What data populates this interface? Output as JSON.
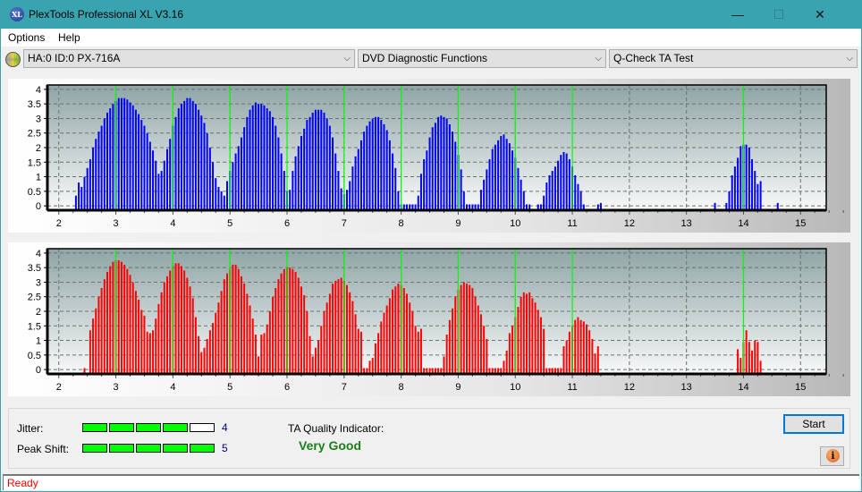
{
  "window": {
    "title": "PlexTools Professional XL V3.16",
    "app_icon_text": "XL",
    "minimize_glyph": "—",
    "maximize_glyph": "☐",
    "close_glyph": "✕"
  },
  "menu": {
    "items": [
      {
        "label": "Options"
      },
      {
        "label": "Help"
      }
    ]
  },
  "toolbar": {
    "drive_select": "HA:0 ID:0  PX-716A",
    "function_select": "DVD Diagnostic Functions",
    "test_select": "Q-Check TA Test",
    "chevron": "⌵"
  },
  "colors": {
    "top_bars": "#0000ff",
    "bottom_bars": "#ff0000",
    "reference_lines": "#00ff00",
    "quality_text": "#1a7f1a",
    "status_text": "#ff0000",
    "meter_on": "#00ff00"
  },
  "chart_data": [
    {
      "type": "bar",
      "title": "",
      "series_name": "top",
      "xlabel": "",
      "ylabel": "",
      "xlim": [
        1.8,
        15.45
      ],
      "ylim": [
        -0.15,
        4.15
      ],
      "xticks": [
        2,
        3,
        4,
        5,
        6,
        7,
        8,
        9,
        10,
        11,
        12,
        13,
        14,
        15
      ],
      "yticks": [
        0,
        0.5,
        1,
        1.5,
        2,
        2.5,
        3,
        3.5,
        4
      ],
      "ytick_labels": [
        "0",
        "0.5",
        "1",
        "1.5",
        "2",
        "2.5",
        "3",
        "3.5",
        "4"
      ],
      "grid": true,
      "reference_lines_x": [
        3,
        4,
        5,
        6,
        7,
        8,
        9,
        10,
        11,
        14
      ],
      "bin_width": 0.05,
      "x_start": 2.3,
      "values": [
        0.35,
        0.8,
        0.65,
        1.0,
        1.3,
        1.6,
        2.0,
        2.3,
        2.55,
        2.75,
        3.0,
        3.2,
        3.35,
        3.5,
        3.6,
        3.7,
        3.7,
        3.7,
        3.65,
        3.55,
        3.45,
        3.3,
        3.15,
        2.95,
        2.75,
        2.5,
        2.2,
        1.9,
        1.55,
        1.1,
        1.2,
        1.55,
        1.95,
        2.3,
        2.75,
        3.05,
        3.35,
        3.5,
        3.6,
        3.7,
        3.7,
        3.6,
        3.5,
        3.3,
        3.1,
        2.85,
        2.5,
        2.0,
        1.5,
        0.95,
        0.65,
        0.5,
        0.35,
        0.85,
        1.2,
        1.5,
        1.8,
        2.05,
        2.35,
        2.7,
        3.05,
        3.3,
        3.45,
        3.55,
        3.5,
        3.5,
        3.45,
        3.35,
        3.25,
        3.05,
        2.75,
        2.35,
        1.8,
        1.2,
        0.5,
        0.55,
        1.2,
        1.7,
        2.05,
        2.4,
        2.65,
        2.95,
        3.05,
        3.2,
        3.3,
        3.3,
        3.3,
        3.2,
        3.0,
        2.75,
        2.35,
        1.8,
        1.2,
        0.6,
        0.4,
        0.55,
        0.85,
        1.35,
        1.7,
        1.95,
        2.25,
        2.55,
        2.75,
        2.9,
        3.0,
        3.05,
        3.05,
        2.95,
        2.8,
        2.6,
        2.25,
        1.8,
        1.3,
        0.5,
        0.05,
        0.05,
        0.05,
        0.05,
        0.05,
        0.05,
        0.35,
        1.1,
        1.6,
        1.9,
        2.35,
        2.7,
        2.85,
        3.05,
        3.1,
        3.05,
        3.0,
        2.8,
        2.55,
        2.2,
        1.75,
        1.25,
        0.5,
        0.05,
        0.05,
        0.05,
        0.05,
        0.05,
        0.55,
        0.9,
        1.25,
        1.6,
        1.95,
        2.1,
        2.25,
        2.4,
        2.45,
        2.3,
        2.15,
        1.9,
        1.65,
        1.3,
        0.9,
        0.5,
        0.05,
        0.05,
        0,
        0,
        0.05,
        0.05,
        0.35,
        0.8,
        1.05,
        1.2,
        1.35,
        1.55,
        1.75,
        1.85,
        1.8,
        1.6,
        1.35,
        1.05,
        0.75,
        0.5,
        0.05,
        0,
        0,
        0,
        0,
        0.05
      ],
      "extra_bars": [
        {
          "x": 10.5,
          "value": 0.05
        },
        {
          "x": 11.5,
          "value": 0.1
        },
        {
          "x": 13.5,
          "value": 0.1
        },
        {
          "x": 13.7,
          "value": 0.1
        },
        {
          "x": 13.75,
          "value": 0.5
        },
        {
          "x": 13.8,
          "value": 1.05
        },
        {
          "x": 13.85,
          "value": 1.35
        },
        {
          "x": 13.9,
          "value": 1.65
        },
        {
          "x": 13.95,
          "value": 2.05
        },
        {
          "x": 14.0,
          "value": 2.1
        },
        {
          "x": 14.05,
          "value": 2.1
        },
        {
          "x": 14.1,
          "value": 2.0
        },
        {
          "x": 14.15,
          "value": 1.6
        },
        {
          "x": 14.2,
          "value": 1.2
        },
        {
          "x": 14.25,
          "value": 0.75
        },
        {
          "x": 14.3,
          "value": 0.85
        },
        {
          "x": 14.6,
          "value": 0.1
        }
      ]
    },
    {
      "type": "bar",
      "title": "",
      "series_name": "bottom",
      "xlabel": "",
      "ylabel": "",
      "xlim": [
        1.8,
        15.45
      ],
      "ylim": [
        -0.15,
        4.15
      ],
      "xticks": [
        2,
        3,
        4,
        5,
        6,
        7,
        8,
        9,
        10,
        11,
        12,
        13,
        14,
        15
      ],
      "yticks": [
        0,
        0.5,
        1,
        1.5,
        2,
        2.5,
        3,
        3.5,
        4
      ],
      "ytick_labels": [
        "0",
        "0.5",
        "1",
        "1.5",
        "2",
        "2.5",
        "3",
        "3.5",
        "4"
      ],
      "grid": true,
      "reference_lines_x": [
        3,
        4,
        5,
        6,
        7,
        8,
        9,
        10,
        11,
        14
      ],
      "bin_width": 0.05,
      "x_start": 2.45,
      "values": [
        0.05,
        0,
        1.35,
        1.75,
        2.1,
        2.5,
        2.8,
        3.1,
        3.35,
        3.55,
        3.7,
        3.75,
        3.75,
        3.7,
        3.6,
        3.45,
        3.25,
        3.0,
        2.7,
        2.4,
        2.05,
        1.85,
        1.3,
        1.25,
        1.35,
        1.75,
        2.25,
        2.65,
        3.0,
        3.2,
        3.4,
        3.55,
        3.65,
        3.65,
        3.55,
        3.4,
        3.15,
        2.85,
        2.45,
        1.8,
        1.15,
        0.6,
        0.75,
        1.05,
        1.35,
        1.6,
        1.95,
        2.3,
        2.7,
        3.1,
        3.3,
        3.45,
        3.6,
        3.6,
        3.45,
        3.2,
        2.95,
        2.6,
        2.2,
        1.75,
        1.2,
        0.45,
        1.2,
        1.25,
        1.55,
        2.0,
        2.5,
        2.8,
        3.1,
        3.3,
        3.45,
        3.5,
        3.5,
        3.45,
        3.35,
        3.15,
        2.85,
        2.55,
        2.0,
        1.15,
        0.45,
        0.75,
        1.0,
        1.5,
        2.0,
        2.3,
        2.6,
        2.95,
        3.05,
        3.1,
        3.15,
        3.05,
        2.9,
        2.65,
        2.35,
        1.9,
        1.4,
        1.3,
        0.05,
        0.05,
        0.3,
        0.4,
        0.9,
        1.25,
        1.65,
        1.95,
        2.2,
        2.45,
        2.75,
        2.85,
        2.95,
        2.9,
        2.8,
        2.6,
        2.3,
        2.0,
        1.5,
        1.3,
        1.4,
        0.05,
        0.05,
        0.05,
        0.05,
        0.05,
        0.05,
        0.05,
        0.45,
        1.2,
        1.7,
        2.1,
        2.5,
        2.75,
        2.9,
        3.0,
        2.95,
        2.9,
        2.8,
        2.5,
        2.2,
        1.9,
        1.5,
        1.05,
        0.05,
        0.05,
        0.05,
        0.05,
        0.05,
        0.3,
        0.65,
        1.25,
        1.5,
        1.8,
        2.15,
        2.5,
        2.65,
        2.6,
        2.65,
        2.45,
        2.3,
        2.05,
        1.8,
        1.4,
        0.05,
        0.05,
        0.05,
        0.05,
        0.05,
        0.05,
        0.8,
        1.0,
        1.3,
        1.5,
        1.7,
        1.8,
        1.7,
        1.65,
        1.55,
        1.35,
        1.05,
        0.55,
        0.8
      ],
      "extra_bars": [
        {
          "x": 10.65,
          "value": 0.05
        },
        {
          "x": 10.7,
          "value": 0.05
        },
        {
          "x": 13.9,
          "value": 0.7
        },
        {
          "x": 13.95,
          "value": 0.4
        },
        {
          "x": 14.0,
          "value": 0.95
        },
        {
          "x": 14.05,
          "value": 1.35
        },
        {
          "x": 14.1,
          "value": 0.95
        },
        {
          "x": 14.15,
          "value": 0.65
        },
        {
          "x": 14.2,
          "value": 1.0
        },
        {
          "x": 14.25,
          "value": 0.95
        },
        {
          "x": 14.3,
          "value": 0.3
        }
      ]
    }
  ],
  "results": {
    "jitter_label": "Jitter:",
    "jitter_value": "4",
    "jitter_level": 4,
    "peak_shift_label": "Peak Shift:",
    "peak_shift_value": "5",
    "peak_shift_level": 5,
    "meter_max": 5,
    "ta_quality_label": "TA Quality Indicator:",
    "ta_quality_value": "Very Good"
  },
  "buttons": {
    "start_label": "Start",
    "info_glyph": "i"
  },
  "status": {
    "text": "Ready"
  }
}
